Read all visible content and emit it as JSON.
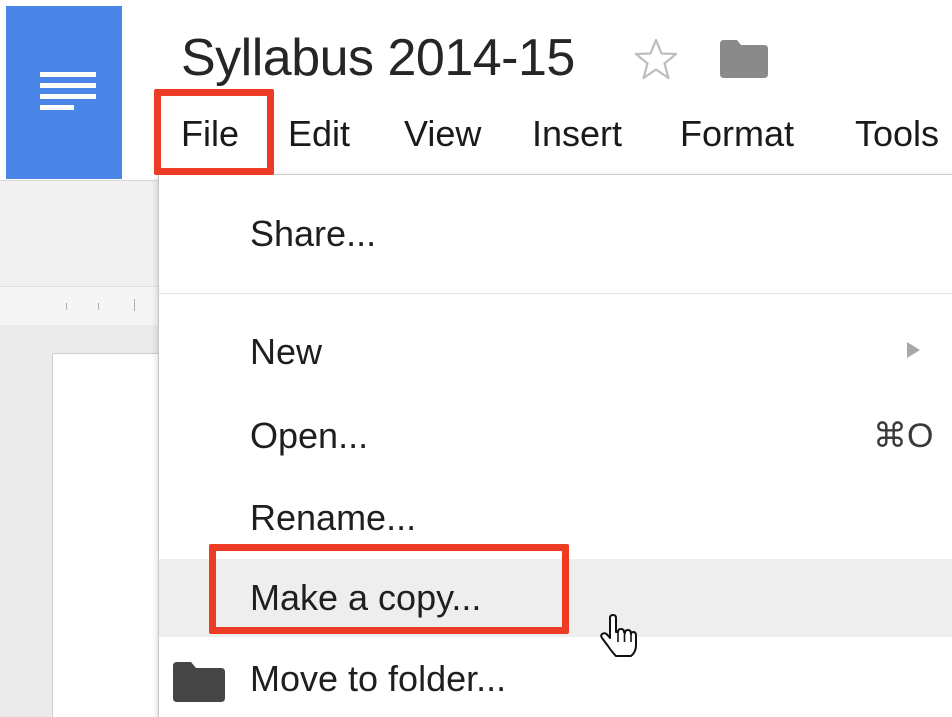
{
  "document": {
    "title": "Syllabus 2014-15"
  },
  "menubar": {
    "items": [
      "File",
      "Edit",
      "View",
      "Insert",
      "Format",
      "Tools"
    ]
  },
  "file_menu": {
    "items": [
      {
        "label": "Share..."
      },
      {
        "label": "New"
      },
      {
        "label": "Open...",
        "shortcut": "⌘O"
      },
      {
        "label": "Rename..."
      },
      {
        "label": "Make a copy..."
      },
      {
        "label": "Move to folder..."
      }
    ]
  },
  "colors": {
    "brand_blue": "#4a86e8",
    "highlight_red": "#ee3b24",
    "hover_gray": "#eeeeee",
    "folder_gray": "#7a7a7a"
  },
  "icons": {
    "logo": "docs-logo-icon",
    "star": "star-icon",
    "folder": "folder-icon",
    "submenu": "chevron-right-icon",
    "cursor": "hand-pointer-icon"
  }
}
